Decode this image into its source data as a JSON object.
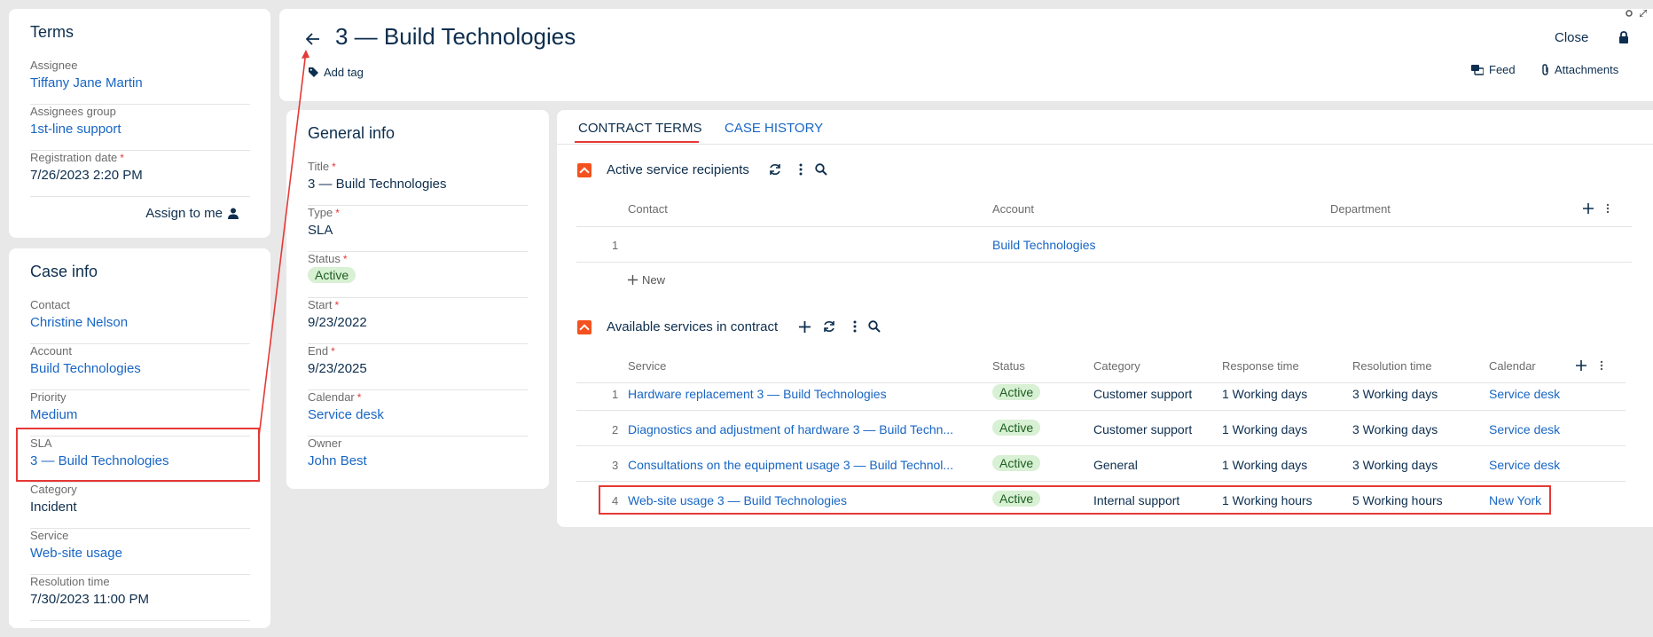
{
  "terms": {
    "title": "Terms",
    "assignee_label": "Assignee",
    "assignee_value": "Tiffany Jane Martin",
    "group_label": "Assignees group",
    "group_value": "1st-line support",
    "reg_label": "Registration date",
    "reg_value": "7/26/2023 2:20 PM",
    "assign_to_me": "Assign to me"
  },
  "case_info": {
    "title": "Case info",
    "contact_label": "Contact",
    "contact_value": "Christine Nelson",
    "account_label": "Account",
    "account_value": "Build Technologies",
    "priority_label": "Priority",
    "priority_value": "Medium",
    "sla_label": "SLA",
    "sla_value": "3 — Build Technologies",
    "category_label": "Category",
    "category_value": "Incident",
    "service_label": "Service",
    "service_value": "Web-site usage",
    "resolution_label": "Resolution time",
    "resolution_value": "7/30/2023 11:00 PM"
  },
  "header": {
    "title": "3 — Build Technologies",
    "add_tag": "Add tag",
    "close": "Close",
    "feed": "Feed",
    "attachments": "Attachments"
  },
  "general": {
    "title": "General info",
    "title_label": "Title",
    "title_value": "3 — Build Technologies",
    "type_label": "Type",
    "type_value": "SLA",
    "status_label": "Status",
    "status_value": "Active",
    "start_label": "Start",
    "start_value": "9/23/2022",
    "end_label": "End",
    "end_value": "9/23/2025",
    "calendar_label": "Calendar",
    "calendar_value": "Service desk",
    "owner_label": "Owner",
    "owner_value": "John Best"
  },
  "tabs": {
    "contract_terms": "CONTRACT TERMS",
    "case_history": "CASE HISTORY"
  },
  "recipients": {
    "title": "Active service recipients",
    "col_contact": "Contact",
    "col_account": "Account",
    "col_department": "Department",
    "rows": [
      {
        "num": "1",
        "contact": "",
        "account": "Build Technologies",
        "department": ""
      }
    ],
    "new": "New"
  },
  "services": {
    "title": "Available services in contract",
    "col_service": "Service",
    "col_status": "Status",
    "col_category": "Category",
    "col_response": "Response time",
    "col_resolution": "Resolution time",
    "col_calendar": "Calendar",
    "rows": [
      {
        "num": "1",
        "service": "Hardware replacement 3 — Build Technologies",
        "status": "Active",
        "category": "Customer support",
        "response": "1 Working days",
        "resolution": "3 Working days",
        "calendar": "Service desk"
      },
      {
        "num": "2",
        "service": "Diagnostics and adjustment of hardware 3 — Build Techn...",
        "status": "Active",
        "category": "Customer support",
        "response": "1 Working days",
        "resolution": "3 Working days",
        "calendar": "Service desk"
      },
      {
        "num": "3",
        "service": "Consultations on the equipment usage 3 — Build Technol...",
        "status": "Active",
        "category": "General",
        "response": "1 Working days",
        "resolution": "3 Working days",
        "calendar": "Service desk"
      },
      {
        "num": "4",
        "service": "Web-site usage 3 — Build Technologies",
        "status": "Active",
        "category": "Internal support",
        "response": "1 Working hours",
        "resolution": "5 Working hours",
        "calendar": "New York"
      }
    ]
  },
  "colors": {
    "accent": "#1866c4",
    "danger": "#e53935",
    "collapse": "#f4511e",
    "badge_bg": "#d8f0d3"
  }
}
